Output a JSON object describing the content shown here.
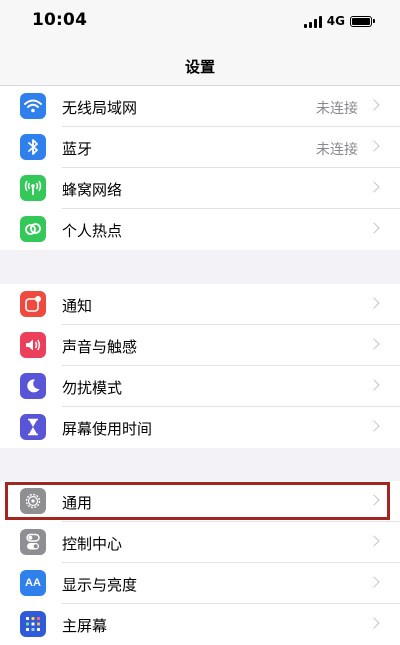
{
  "status_bar": {
    "time": "10:04",
    "network": "4G"
  },
  "nav": {
    "title": "设置"
  },
  "groups": [
    {
      "items": [
        {
          "label": "无线局域网",
          "value": "未连接",
          "icon": "wifi-icon",
          "color": "#2f80ed"
        },
        {
          "label": "蓝牙",
          "value": "未连接",
          "icon": "bluetooth-icon",
          "color": "#2f80ed"
        },
        {
          "label": "蜂窝网络",
          "value": "",
          "icon": "cellular-antenna-icon",
          "color": "#34c759"
        },
        {
          "label": "个人热点",
          "value": "",
          "icon": "hotspot-link-icon",
          "color": "#34c759"
        }
      ]
    },
    {
      "items": [
        {
          "label": "通知",
          "value": "",
          "icon": "notification-icon",
          "color": "#ee4a3f"
        },
        {
          "label": "声音与触感",
          "value": "",
          "icon": "speaker-icon",
          "color": "#ec3f5b"
        },
        {
          "label": "勿扰模式",
          "value": "",
          "icon": "moon-icon",
          "color": "#5856d6"
        },
        {
          "label": "屏幕使用时间",
          "value": "",
          "icon": "hourglass-icon",
          "color": "#5856d6"
        }
      ]
    },
    {
      "items": [
        {
          "label": "通用",
          "value": "",
          "icon": "gear-icon",
          "color": "#8e8e93",
          "highlighted": true
        },
        {
          "label": "控制中心",
          "value": "",
          "icon": "toggles-icon",
          "color": "#8e8e93"
        },
        {
          "label": "显示与亮度",
          "value": "",
          "icon": "text-size-icon",
          "color": "#2f80ed"
        },
        {
          "label": "主屏幕",
          "value": "",
          "icon": "home-screen-grid-icon",
          "color": "#2f5bd8"
        }
      ]
    }
  ],
  "display_icon_text": "AA",
  "highlight_color": "#a52620"
}
